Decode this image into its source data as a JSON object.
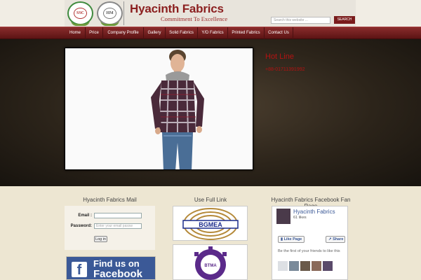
{
  "header": {
    "seal_left_text": "SSC",
    "seal_right_text": "HM",
    "brand_title": "Hyacinth Fabrics",
    "brand_tagline": "Commitment To Excellence",
    "search_placeholder": "Search this website ...",
    "search_button": "SEARCH"
  },
  "nav": {
    "items": [
      "Home",
      "Price",
      "Company Profile",
      "Gallery",
      "Solid Fabrics",
      "Y/D Fabrics",
      "Printed Fabrics",
      "Contact Us"
    ]
  },
  "hotline": {
    "title": "Hot Line",
    "number": "+88-01711391992"
  },
  "mail_widget": {
    "title": "Hyacinth Fabrics Mail",
    "email_label": "Email :",
    "password_label": "Password:",
    "password_placeholder": "Enter your email passw",
    "login_button": "Log in"
  },
  "fb_banner": {
    "line1": "Find us on",
    "line2": "Facebook"
  },
  "links_widget": {
    "title": "Use Full Link",
    "bgmea_label": "BGMEA",
    "btma_label": "BTMA"
  },
  "fb_page": {
    "title": "Hyacinth Fabrics Facebook Fan Page",
    "page_name": "Hyacinth Fabrics",
    "likes": "61 likes",
    "like_button": "Like Page",
    "share_button": "Share",
    "friends_text": "Be the first of your friends to like this"
  },
  "colors": {
    "brand_red": "#8b1f1f",
    "hotline_red": "#b31212",
    "facebook_blue": "#3b5997"
  }
}
